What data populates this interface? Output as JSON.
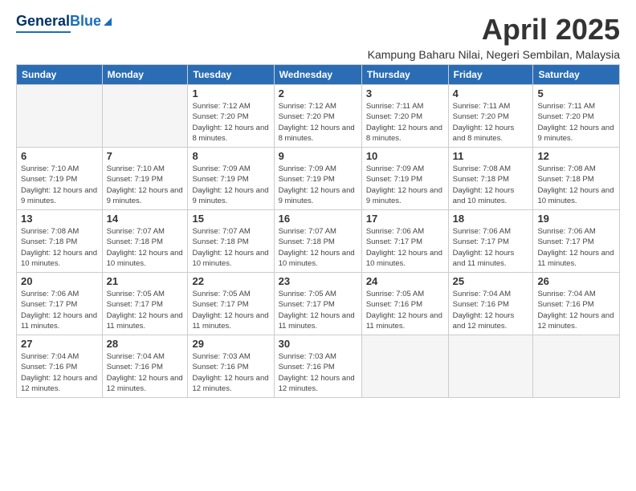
{
  "logo": {
    "general": "General",
    "blue": "Blue"
  },
  "title": "April 2025",
  "location": "Kampung Baharu Nilai, Negeri Sembilan, Malaysia",
  "days_header": [
    "Sunday",
    "Monday",
    "Tuesday",
    "Wednesday",
    "Thursday",
    "Friday",
    "Saturday"
  ],
  "weeks": [
    [
      {
        "day": "",
        "info": ""
      },
      {
        "day": "",
        "info": ""
      },
      {
        "day": "1",
        "info": "Sunrise: 7:12 AM\nSunset: 7:20 PM\nDaylight: 12 hours and 8 minutes."
      },
      {
        "day": "2",
        "info": "Sunrise: 7:12 AM\nSunset: 7:20 PM\nDaylight: 12 hours and 8 minutes."
      },
      {
        "day": "3",
        "info": "Sunrise: 7:11 AM\nSunset: 7:20 PM\nDaylight: 12 hours and 8 minutes."
      },
      {
        "day": "4",
        "info": "Sunrise: 7:11 AM\nSunset: 7:20 PM\nDaylight: 12 hours and 8 minutes."
      },
      {
        "day": "5",
        "info": "Sunrise: 7:11 AM\nSunset: 7:20 PM\nDaylight: 12 hours and 9 minutes."
      }
    ],
    [
      {
        "day": "6",
        "info": "Sunrise: 7:10 AM\nSunset: 7:19 PM\nDaylight: 12 hours and 9 minutes."
      },
      {
        "day": "7",
        "info": "Sunrise: 7:10 AM\nSunset: 7:19 PM\nDaylight: 12 hours and 9 minutes."
      },
      {
        "day": "8",
        "info": "Sunrise: 7:09 AM\nSunset: 7:19 PM\nDaylight: 12 hours and 9 minutes."
      },
      {
        "day": "9",
        "info": "Sunrise: 7:09 AM\nSunset: 7:19 PM\nDaylight: 12 hours and 9 minutes."
      },
      {
        "day": "10",
        "info": "Sunrise: 7:09 AM\nSunset: 7:19 PM\nDaylight: 12 hours and 9 minutes."
      },
      {
        "day": "11",
        "info": "Sunrise: 7:08 AM\nSunset: 7:18 PM\nDaylight: 12 hours and 10 minutes."
      },
      {
        "day": "12",
        "info": "Sunrise: 7:08 AM\nSunset: 7:18 PM\nDaylight: 12 hours and 10 minutes."
      }
    ],
    [
      {
        "day": "13",
        "info": "Sunrise: 7:08 AM\nSunset: 7:18 PM\nDaylight: 12 hours and 10 minutes."
      },
      {
        "day": "14",
        "info": "Sunrise: 7:07 AM\nSunset: 7:18 PM\nDaylight: 12 hours and 10 minutes."
      },
      {
        "day": "15",
        "info": "Sunrise: 7:07 AM\nSunset: 7:18 PM\nDaylight: 12 hours and 10 minutes."
      },
      {
        "day": "16",
        "info": "Sunrise: 7:07 AM\nSunset: 7:18 PM\nDaylight: 12 hours and 10 minutes."
      },
      {
        "day": "17",
        "info": "Sunrise: 7:06 AM\nSunset: 7:17 PM\nDaylight: 12 hours and 10 minutes."
      },
      {
        "day": "18",
        "info": "Sunrise: 7:06 AM\nSunset: 7:17 PM\nDaylight: 12 hours and 11 minutes."
      },
      {
        "day": "19",
        "info": "Sunrise: 7:06 AM\nSunset: 7:17 PM\nDaylight: 12 hours and 11 minutes."
      }
    ],
    [
      {
        "day": "20",
        "info": "Sunrise: 7:06 AM\nSunset: 7:17 PM\nDaylight: 12 hours and 11 minutes."
      },
      {
        "day": "21",
        "info": "Sunrise: 7:05 AM\nSunset: 7:17 PM\nDaylight: 12 hours and 11 minutes."
      },
      {
        "day": "22",
        "info": "Sunrise: 7:05 AM\nSunset: 7:17 PM\nDaylight: 12 hours and 11 minutes."
      },
      {
        "day": "23",
        "info": "Sunrise: 7:05 AM\nSunset: 7:17 PM\nDaylight: 12 hours and 11 minutes."
      },
      {
        "day": "24",
        "info": "Sunrise: 7:05 AM\nSunset: 7:16 PM\nDaylight: 12 hours and 11 minutes."
      },
      {
        "day": "25",
        "info": "Sunrise: 7:04 AM\nSunset: 7:16 PM\nDaylight: 12 hours and 12 minutes."
      },
      {
        "day": "26",
        "info": "Sunrise: 7:04 AM\nSunset: 7:16 PM\nDaylight: 12 hours and 12 minutes."
      }
    ],
    [
      {
        "day": "27",
        "info": "Sunrise: 7:04 AM\nSunset: 7:16 PM\nDaylight: 12 hours and 12 minutes."
      },
      {
        "day": "28",
        "info": "Sunrise: 7:04 AM\nSunset: 7:16 PM\nDaylight: 12 hours and 12 minutes."
      },
      {
        "day": "29",
        "info": "Sunrise: 7:03 AM\nSunset: 7:16 PM\nDaylight: 12 hours and 12 minutes."
      },
      {
        "day": "30",
        "info": "Sunrise: 7:03 AM\nSunset: 7:16 PM\nDaylight: 12 hours and 12 minutes."
      },
      {
        "day": "",
        "info": ""
      },
      {
        "day": "",
        "info": ""
      },
      {
        "day": "",
        "info": ""
      }
    ]
  ]
}
